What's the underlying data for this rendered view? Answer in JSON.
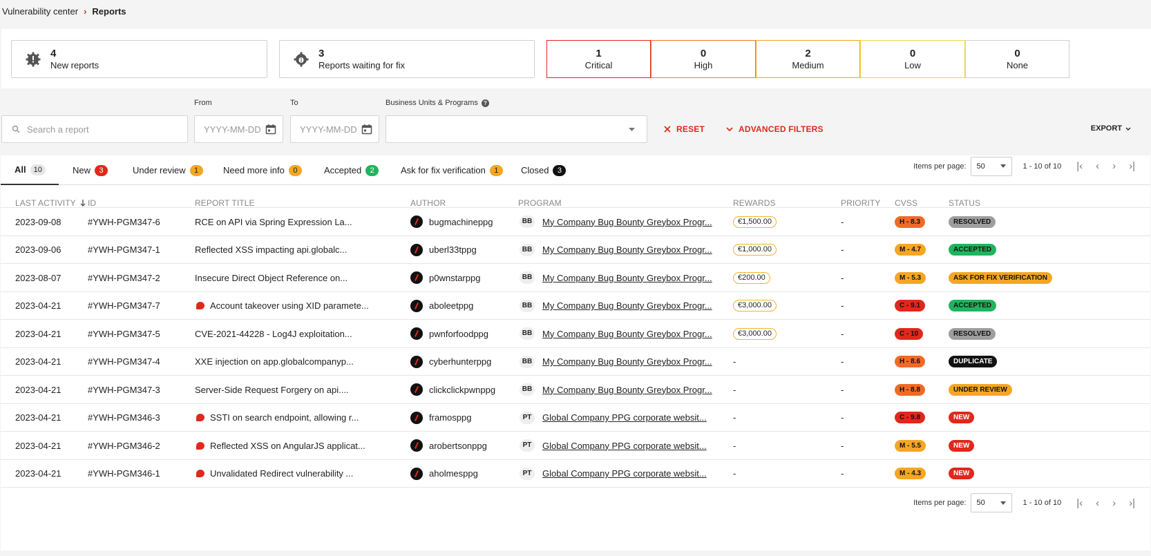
{
  "breadcrumb": {
    "parent": "Vulnerability center",
    "current": "Reports"
  },
  "stats": {
    "new_reports": {
      "count": "4",
      "label": "New reports"
    },
    "waiting_fix": {
      "count": "3",
      "label": "Reports waiting for fix"
    }
  },
  "severity": [
    {
      "count": "1",
      "label": "Critical",
      "color": "#e0281c"
    },
    {
      "count": "0",
      "label": "High",
      "color": "#f07b22"
    },
    {
      "count": "2",
      "label": "Medium",
      "color": "#f0a81f"
    },
    {
      "count": "0",
      "label": "Low",
      "color": "#f5d34a"
    },
    {
      "count": "0",
      "label": "None",
      "color": "#cfd0d4"
    }
  ],
  "filters": {
    "search_placeholder": "Search a report",
    "from_label": "From",
    "from_placeholder": "YYYY-MM-DD",
    "to_label": "To",
    "to_placeholder": "YYYY-MM-DD",
    "bu_label": "Business Units & Programs",
    "reset": "RESET",
    "advanced": "ADVANCED FILTERS",
    "export": "EXPORT"
  },
  "tabs": [
    {
      "label": "All",
      "count": "10",
      "bg": "#e6e6e6",
      "fg": "#222"
    },
    {
      "label": "New",
      "count": "3",
      "bg": "#e0281c",
      "fg": "#fff"
    },
    {
      "label": "Under review",
      "count": "1",
      "bg": "#f5a623",
      "fg": "#222"
    },
    {
      "label": "Need more info",
      "count": "0",
      "bg": "#f5a623",
      "fg": "#222"
    },
    {
      "label": "Accepted",
      "count": "2",
      "bg": "#22b35e",
      "fg": "#fff"
    },
    {
      "label": "Ask for fix verification",
      "count": "1",
      "bg": "#f5a623",
      "fg": "#222"
    },
    {
      "label": "Closed",
      "count": "3",
      "bg": "#111",
      "fg": "#fff"
    }
  ],
  "pager": {
    "label": "Items per page:",
    "value": "50",
    "range": "1 - 10 of 10"
  },
  "columns": {
    "last_activity": "LAST ACTIVITY",
    "id": "ID",
    "title": "REPORT TITLE",
    "author": "AUTHOR",
    "program": "PROGRAM",
    "rewards": "REWARDS",
    "priority": "PRIORITY",
    "cvss": "CVSS",
    "status": "STATUS"
  },
  "rows": [
    {
      "date": "2023-09-08",
      "id": "#YWH-PGM347-6",
      "title": "RCE on API via Spring Expression La...",
      "flag": false,
      "author": "bugmachineppg",
      "prog_type": "BB",
      "program": "My Company Bug Bounty Greybox Progr...",
      "reward": "€1,500.00",
      "priority": "-",
      "cvss": "H - 8.3",
      "cvss_bg": "#f06a27",
      "status": "RESOLVED",
      "status_bg": "#9e9e9e",
      "status_fg": "#111"
    },
    {
      "date": "2023-09-06",
      "id": "#YWH-PGM347-1",
      "title": "Reflected XSS impacting api.globalc...",
      "flag": false,
      "author": "uberl33tppg",
      "prog_type": "BB",
      "program": "My Company Bug Bounty Greybox Progr...",
      "reward": "€1,000.00",
      "priority": "-",
      "cvss": "M - 4.7",
      "cvss_bg": "#f5a623",
      "status": "ACCEPTED",
      "status_bg": "#22b35e",
      "status_fg": "#111"
    },
    {
      "date": "2023-08-07",
      "id": "#YWH-PGM347-2",
      "title": "Insecure Direct Object Reference on...",
      "flag": false,
      "author": "p0wnstarppg",
      "prog_type": "BB",
      "program": "My Company Bug Bounty Greybox Progr...",
      "reward": "€200.00",
      "priority": "-",
      "cvss": "M - 5.3",
      "cvss_bg": "#f5a623",
      "status": "ASK FOR FIX VERIFICATION",
      "status_bg": "#f5a623",
      "status_fg": "#111"
    },
    {
      "date": "2023-04-21",
      "id": "#YWH-PGM347-7",
      "title": "Account takeover using XID paramete...",
      "flag": true,
      "author": "aboleetppg",
      "prog_type": "BB",
      "program": "My Company Bug Bounty Greybox Progr...",
      "reward": "€3,000.00",
      "priority": "-",
      "cvss": "C - 9.1",
      "cvss_bg": "#e0281c",
      "status": "ACCEPTED",
      "status_bg": "#22b35e",
      "status_fg": "#111"
    },
    {
      "date": "2023-04-21",
      "id": "#YWH-PGM347-5",
      "title": "CVE-2021-44228 - Log4J exploitation...",
      "flag": false,
      "author": "pwnforfoodppg",
      "prog_type": "BB",
      "program": "My Company Bug Bounty Greybox Progr...",
      "reward": "€3,000.00",
      "priority": "-",
      "cvss": "C - 10",
      "cvss_bg": "#e0281c",
      "status": "RESOLVED",
      "status_bg": "#9e9e9e",
      "status_fg": "#111"
    },
    {
      "date": "2023-04-21",
      "id": "#YWH-PGM347-4",
      "title": "XXE injection on app.globalcompanyp...",
      "flag": false,
      "author": "cyberhunterppg",
      "prog_type": "BB",
      "program": "My Company Bug Bounty Greybox Progr...",
      "reward": "-",
      "priority": "-",
      "cvss": "H - 8.6",
      "cvss_bg": "#f06a27",
      "status": "DUPLICATE",
      "status_bg": "#111",
      "status_fg": "#fff"
    },
    {
      "date": "2023-04-21",
      "id": "#YWH-PGM347-3",
      "title": "Server-Side Request Forgery on api....",
      "flag": false,
      "author": "clickclickpwnppg",
      "prog_type": "BB",
      "program": "My Company Bug Bounty Greybox Progr...",
      "reward": "-",
      "priority": "-",
      "cvss": "H - 8.8",
      "cvss_bg": "#f06a27",
      "status": "UNDER REVIEW",
      "status_bg": "#f5a623",
      "status_fg": "#111"
    },
    {
      "date": "2023-04-21",
      "id": "#YWH-PGM346-3",
      "title": "SSTI on search endpoint, allowing r...",
      "flag": true,
      "author": "framosppg",
      "prog_type": "PT",
      "program": "Global Company PPG corporate websit...",
      "reward": "-",
      "priority": "-",
      "cvss": "C - 9.8",
      "cvss_bg": "#e0281c",
      "status": "NEW",
      "status_bg": "#e0281c",
      "status_fg": "#fff"
    },
    {
      "date": "2023-04-21",
      "id": "#YWH-PGM346-2",
      "title": "Reflected XSS on AngularJS applicat...",
      "flag": true,
      "author": "arobertsonppg",
      "prog_type": "PT",
      "program": "Global Company PPG corporate websit...",
      "reward": "-",
      "priority": "-",
      "cvss": "M - 5.5",
      "cvss_bg": "#f5a623",
      "status": "NEW",
      "status_bg": "#e0281c",
      "status_fg": "#fff"
    },
    {
      "date": "2023-04-21",
      "id": "#YWH-PGM346-1",
      "title": "Unvalidated Redirect vulnerability ...",
      "flag": true,
      "author": "aholmesppg",
      "prog_type": "PT",
      "program": "Global Company PPG corporate websit...",
      "reward": "-",
      "priority": "-",
      "cvss": "M - 4.3",
      "cvss_bg": "#f5a623",
      "status": "NEW",
      "status_bg": "#e0281c",
      "status_fg": "#fff"
    }
  ]
}
